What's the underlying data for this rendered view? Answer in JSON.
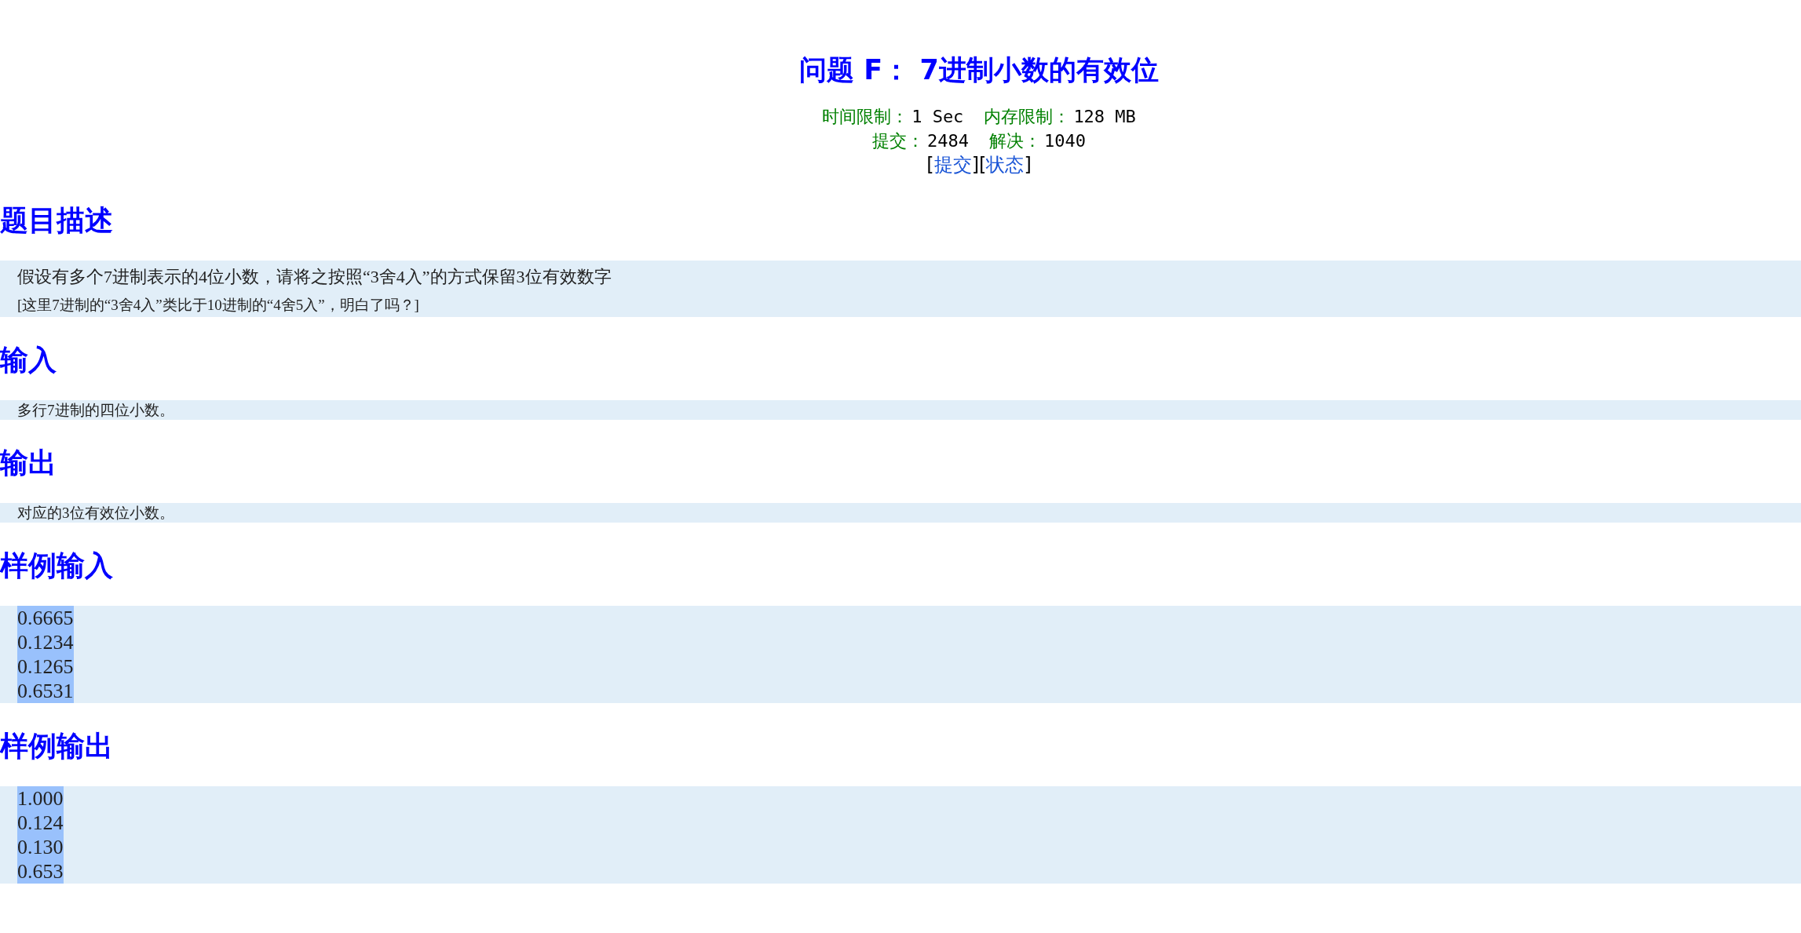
{
  "title": "问题 F： 7进制小数的有效位",
  "limits": [
    {
      "label": "时间限制：",
      "value": "1 Sec"
    },
    {
      "label": "内存限制：",
      "value": "128 MB"
    }
  ],
  "stats": [
    {
      "label": "提交：",
      "value": "2484"
    },
    {
      "label": "解决：",
      "value": "1040"
    }
  ],
  "links": [
    {
      "open": "[",
      "label": "提交",
      "close": "]"
    },
    {
      "open": "[",
      "label": "状态",
      "close": "]"
    }
  ],
  "sections": [
    {
      "heading": "题目描述",
      "kind": "text",
      "lines": [
        "假设有多个7进制表示的4位小数，请将之按照“3舍4入”的方式保留3位有效数字",
        "[这里7进制的“3舍4入”类比于10进制的“4舍5入”，明白了吗？]"
      ]
    },
    {
      "heading": "输入",
      "kind": "text",
      "lines": [
        "多行7进制的四位小数。"
      ]
    },
    {
      "heading": "输出",
      "kind": "text",
      "lines": [
        "对应的3位有效位小数。"
      ]
    },
    {
      "heading": "样例输入",
      "kind": "sample",
      "lines": [
        {
          "text": "0.6665",
          "highlighted": true
        },
        {
          "text": "0.1234",
          "highlighted": true
        },
        {
          "text": "0.1265",
          "highlighted": true
        },
        {
          "text": "0.6531",
          "highlighted": true
        }
      ]
    },
    {
      "heading": "样例输出",
      "kind": "sample",
      "lines": [
        {
          "text": "1.000",
          "highlighted": true
        },
        {
          "text": "0.124",
          "highlighted": true
        },
        {
          "text": "0.130",
          "highlighted": true
        },
        {
          "text": "0.653",
          "highlighted": true
        }
      ]
    }
  ]
}
